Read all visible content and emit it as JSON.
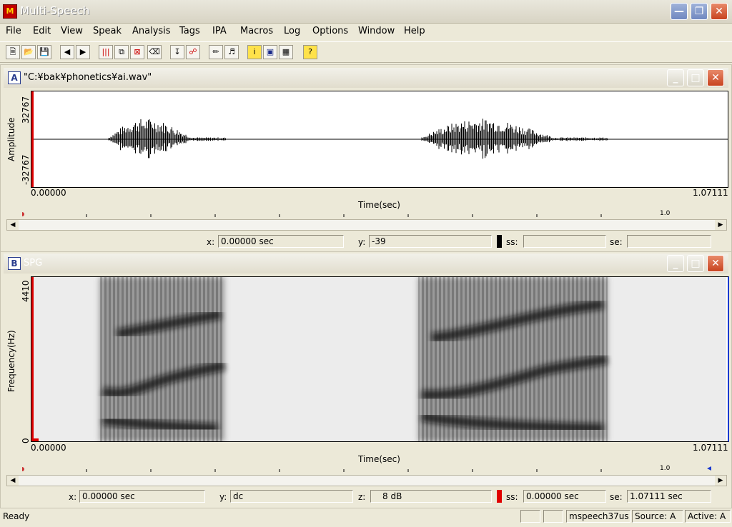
{
  "app": {
    "title": "Multi-Speech"
  },
  "menu": [
    "File",
    "Edit",
    "View",
    "Speak",
    "Analysis",
    "Tags",
    "IPA",
    "Macros",
    "Log",
    "Options",
    "Window",
    "Help"
  ],
  "toolbar_icons": [
    "new-file-icon",
    "open-folder-icon",
    "save-icon",
    "back-arrow-icon",
    "forward-arrow-icon",
    "waveform-bars-icon",
    "copy-window-icon",
    "delete-window-icon",
    "eraser-icon",
    "download-arrow-icon",
    "link-icon",
    "microphone-icon",
    "speaker-icon",
    "info-icon",
    "display-window-icon",
    "grid-window-icon",
    "help-icon"
  ],
  "window_a": {
    "letter": "A",
    "title": "\"C:¥bak¥phonetics¥ai.wav\"",
    "y_label": "Amplitude",
    "y_max": "32767",
    "y_min": "-32767",
    "x_start": "0.00000",
    "x_end": "1.07111",
    "x_label": "Time(sec)",
    "ruler_label": "1.0",
    "status": {
      "x_label": "x:",
      "x_value": "0.00000 sec",
      "y_label": "y:",
      "y_value": "-39",
      "ss_label": "ss:",
      "ss_value": "",
      "se_label": "se:",
      "se_value": ""
    }
  },
  "window_b": {
    "letter": "B",
    "title": "SPG",
    "y_label": "Frequency(Hz)",
    "y_max": "4410",
    "y_min": "0",
    "x_start": "0.00000",
    "x_end": "1.07111",
    "x_label": "Time(sec)",
    "ruler_label": "1.0",
    "status": {
      "x_label": "x:",
      "x_value": "0.00000 sec",
      "y_label": "y:",
      "y_value": "dc",
      "z_label": "z:",
      "z_value": "8 dB",
      "ss_label": "ss:",
      "ss_value": "0.00000 sec",
      "se_label": "se:",
      "se_value": "1.07111 sec"
    }
  },
  "statusbar": {
    "ready": "Ready",
    "app_name": "mspeech37us",
    "source": "Source: A",
    "active": "Active: A"
  },
  "colors": {
    "cursor": "#e00000",
    "title_text": "#ffffff",
    "frame": "#ece9d8"
  }
}
